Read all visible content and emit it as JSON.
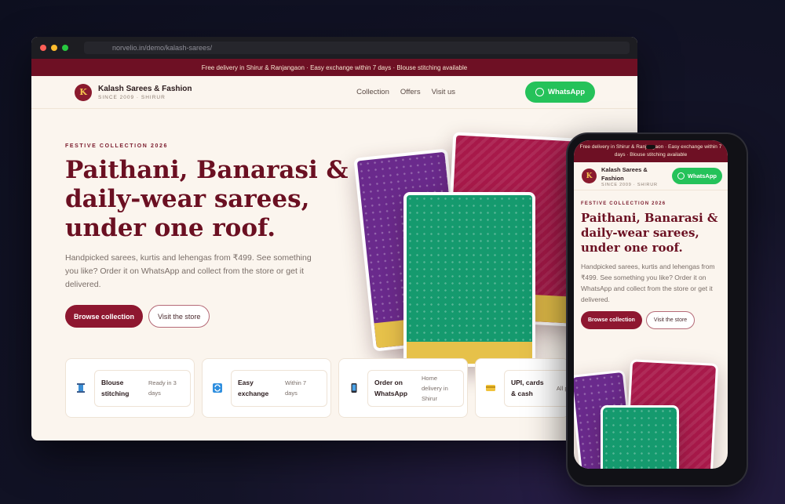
{
  "browser": {
    "url": "norvelio.in/demo/kalash-sarees/",
    "dots": [
      "#ff5f57",
      "#febc2e",
      "#28c840"
    ]
  },
  "site": {
    "promo": "Free delivery in Shirur & Ranjangaon · Easy exchange within 7 days · Blouse stitching available",
    "logo_letter": "K",
    "brand_name": "Kalash Sarees & Fashion",
    "brand_sub": "SINCE 2009 · SHIRUR",
    "nav": [
      "Collection",
      "Offers",
      "Visit us"
    ],
    "whatsapp_label": "WhatsApp",
    "eyebrow": "FESTIVE COLLECTION 2026",
    "headline": "Paithani, Banarasi & daily-wear sarees, under one roof.",
    "subcopy": "Handpicked sarees, kurtis and lehengas from ₹499. See something you like? Order it on WhatsApp and collect from the store or get it delivered.",
    "cta_primary": "Browse collection",
    "cta_secondary": "Visit the store",
    "features": [
      {
        "icon": "thread-spool-icon",
        "title": "Blouse stitching",
        "desc": "Ready in 3 days"
      },
      {
        "icon": "exchange-icon",
        "title": "Easy exchange",
        "desc": "Within 7 days"
      },
      {
        "icon": "phone-icon",
        "title": "Order on WhatsApp",
        "desc": "Home delivery in Shirur"
      },
      {
        "icon": "card-icon",
        "title": "UPI, cards & cash",
        "desc": "All pa accep"
      }
    ]
  },
  "phone": {
    "promo": "Free delivery in Shirur & Ranjangaon · Easy exchange within 7 days · Blouse stitching available",
    "brand_name": "Kalash Sarees & Fashion",
    "brand_sub": "SINCE 2009 · SHIRUR",
    "whatsapp_label": "WhatsApp",
    "eyebrow": "FESTIVE COLLECTION 2026",
    "headline": "Paithani, Banarasi & daily-wear sarees, under one roof.",
    "subcopy": "Handpicked sarees, kurtis and lehengas from ₹499. See something you like? Order it on WhatsApp and collect from the store or get it delivered.",
    "cta_primary": "Browse collection",
    "cta_secondary": "Visit the store"
  },
  "colors": {
    "brand_maroon": "#6e1024",
    "whatsapp_green": "#25c25a",
    "saree_purple": "#6a2a8c",
    "saree_magenta": "#a8194a",
    "saree_green": "#159a6e",
    "saree_gold": "#e6c14a"
  }
}
